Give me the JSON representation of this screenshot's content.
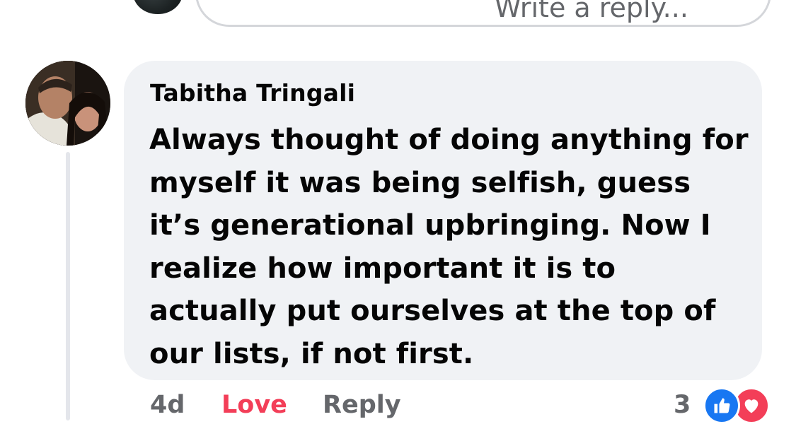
{
  "reply_box": {
    "placeholder": "Write a reply..."
  },
  "comment": {
    "author": "Tabitha Tringali",
    "text": "Always thought of doing anything for myself it was being selfish, guess it’s generational upbringing. Now I realize how important it is to actually put ourselves at the top of our lists, if not first.",
    "time": "4d",
    "love_label": "Love",
    "reply_label": "Reply",
    "reaction_count": "3",
    "reactions": [
      "like-icon",
      "heart-icon"
    ]
  },
  "colors": {
    "bubble": "#f0f2f5",
    "love": "#f33e58",
    "meta_gray": "#65676b",
    "like_blue": "#1877f2"
  }
}
